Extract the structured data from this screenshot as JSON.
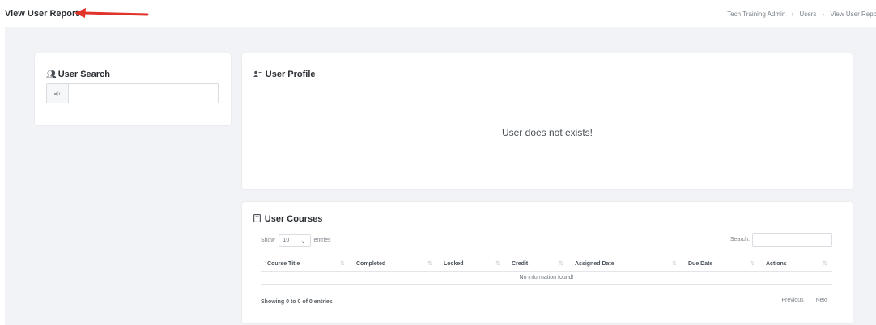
{
  "header": {
    "page_title": "View User Report",
    "breadcrumb": [
      "Tech Training Admin",
      "Users",
      "View User Report"
    ],
    "breadcrumb_separator": "›"
  },
  "annotation": {
    "arrow_color": "#e0342b"
  },
  "user_search": {
    "title": "User Search",
    "title_icon": "users-search-icon",
    "addon_icon": "speaker-icon",
    "input_value": "",
    "input_placeholder": ""
  },
  "user_profile": {
    "title": "User Profile",
    "title_icon": "user-profile-icon",
    "message": "User does not exists!"
  },
  "user_courses": {
    "title": "User Courses",
    "title_icon": "book-icon",
    "show_label": "Show",
    "entries_value": "10",
    "entries_label": "entries",
    "search_label": "Search:",
    "search_value": "",
    "columns": [
      "Course Title",
      "Completed",
      "Locked",
      "Credit",
      "Assigned Date",
      "Due Date",
      "Actions"
    ],
    "empty_message": "No information found!",
    "info": "Showing 0 to 0 of 0 entries",
    "previous": "Previous",
    "next": "Next"
  }
}
